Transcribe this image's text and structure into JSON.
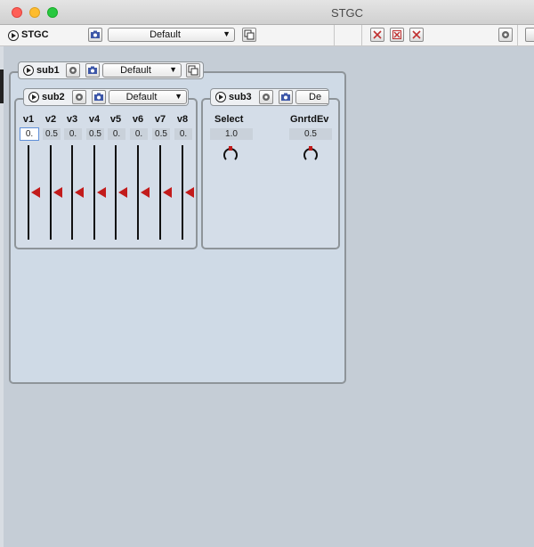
{
  "window": {
    "title": "STGC"
  },
  "toolbar": {
    "name": "STGC",
    "preset": "Default"
  },
  "sub1": {
    "name": "sub1",
    "preset": "Default"
  },
  "sub2": {
    "name": "sub2",
    "preset": "Default",
    "channels": [
      {
        "label": "v1",
        "value": "0.",
        "level": 0.5
      },
      {
        "label": "v2",
        "value": "0.5",
        "level": 0.5
      },
      {
        "label": "v3",
        "value": "0.",
        "level": 0.5
      },
      {
        "label": "v4",
        "value": "0.5",
        "level": 0.5
      },
      {
        "label": "v5",
        "value": "0.",
        "level": 0.5
      },
      {
        "label": "v6",
        "value": "0.",
        "level": 0.5
      },
      {
        "label": "v7",
        "value": "0.5",
        "level": 0.5
      },
      {
        "label": "v8",
        "value": "0.",
        "level": 0.5
      }
    ]
  },
  "sub3": {
    "name": "sub3",
    "preset": "De",
    "controls": [
      {
        "label": "Select",
        "value": "1.0"
      },
      {
        "label": "GnrtdEv",
        "value": "0.5"
      }
    ]
  },
  "colors": {
    "thumb": "#c21b1b",
    "panel": "#cfdae6",
    "background": "#c5cdd6"
  }
}
